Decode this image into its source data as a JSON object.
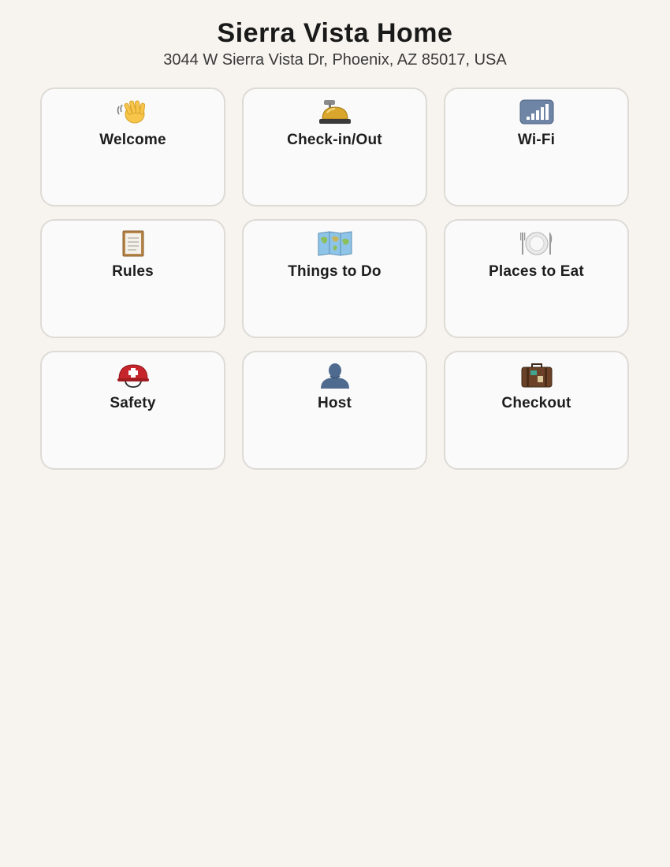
{
  "header": {
    "title": "Sierra Vista Home",
    "address": "3044 W Sierra Vista Dr, Phoenix, AZ 85017, USA"
  },
  "cards": [
    {
      "label": "Welcome",
      "icon": "waving-hand-icon"
    },
    {
      "label": "Check-in/Out",
      "icon": "bellhop-bell-icon"
    },
    {
      "label": "Wi-Fi",
      "icon": "signal-bars-icon"
    },
    {
      "label": "Rules",
      "icon": "clipboard-icon"
    },
    {
      "label": "Things to Do",
      "icon": "world-map-icon"
    },
    {
      "label": "Places to Eat",
      "icon": "fork-knife-plate-icon"
    },
    {
      "label": "Safety",
      "icon": "rescue-helmet-icon"
    },
    {
      "label": "Host",
      "icon": "person-silhouette-icon"
    },
    {
      "label": "Checkout",
      "icon": "luggage-icon"
    }
  ]
}
